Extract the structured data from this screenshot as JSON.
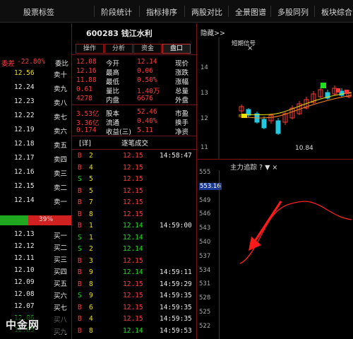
{
  "menu": [
    "板块综合",
    "多股同列",
    "全景图谱",
    "两股对比",
    "指标排序",
    "阶段统计",
    "股票标签"
  ],
  "stock": {
    "title": "600283 钱江水利"
  },
  "tabs": [
    "盘口",
    "资金",
    "分析",
    "操作"
  ],
  "quote_rows": [
    {
      "l": "现价",
      "lv": "12.14",
      "r": "今开",
      "rv": "12.08"
    },
    {
      "l": "涨跌",
      "lv": "0.06",
      "r": "最高",
      "rv": "12.16"
    },
    {
      "l": "涨幅",
      "lv": "0.50%",
      "r": "最低",
      "rv": "11.88"
    },
    {
      "l": "总量",
      "lv": "1.40万",
      "r": "量比",
      "rv": "0.61"
    },
    {
      "l": "外盘",
      "lv": "6676",
      "r": "内盘",
      "rv": "4278"
    }
  ],
  "quote_rows2": [
    {
      "l": "市盈",
      "lv": "52.46",
      "r": "股本",
      "rv": "3.53亿"
    },
    {
      "l": "换手",
      "lv": "0.40%",
      "r": "流通",
      "rv": "3.36亿"
    },
    {
      "l": "净资",
      "lv": "5.11",
      "r": "收益(三)",
      "rv": "0.174"
    }
  ],
  "trade_header": "逐笔成交",
  "trade_header_tag": "[详]",
  "trades": [
    {
      "t": "14:58:47",
      "p": "12.15",
      "v": "2",
      "f": "B"
    },
    {
      "t": "",
      "p": "12.15",
      "v": "4",
      "f": "B"
    },
    {
      "t": "",
      "p": "12.15",
      "v": "5",
      "f": "S"
    },
    {
      "t": "",
      "p": "12.15",
      "v": "5",
      "f": "B"
    },
    {
      "t": "",
      "p": "12.15",
      "v": "7",
      "f": "B"
    },
    {
      "t": "",
      "p": "12.15",
      "v": "8",
      "f": "B"
    },
    {
      "t": "14:59:00",
      "p": "12.14",
      "v": "1",
      "f": "B"
    },
    {
      "t": "",
      "p": "12.14",
      "v": "1",
      "f": "S"
    },
    {
      "t": "",
      "p": "12.14",
      "v": "2",
      "f": "S"
    },
    {
      "t": "",
      "p": "12.15",
      "v": "3",
      "f": "B"
    },
    {
      "t": "14:59:11",
      "p": "12.14",
      "v": "9",
      "f": "B"
    },
    {
      "t": "14:59:29",
      "p": "12.15",
      "v": "8",
      "f": "B"
    },
    {
      "t": "14:59:35",
      "p": "12.15",
      "v": "9",
      "f": "S"
    },
    {
      "t": "14:59:35",
      "p": "12.15",
      "v": "6",
      "f": "B"
    },
    {
      "t": "14:59:35",
      "p": "12.15",
      "v": "4",
      "f": "B"
    },
    {
      "t": "14:59:53",
      "p": "12.14",
      "v": "8",
      "f": "B"
    }
  ],
  "book_top": {
    "label": "委比",
    "value": "-22.80%",
    "side": "委差"
  },
  "book_rows": [
    {
      "n": "卖十",
      "p": "12.56",
      "c": "yellow"
    },
    {
      "n": "卖九",
      "p": "12.24",
      "c": "white"
    },
    {
      "n": "卖八",
      "p": "12.23",
      "c": "white"
    },
    {
      "n": "卖七",
      "p": "12.22",
      "c": "white"
    },
    {
      "n": "卖六",
      "p": "12.19",
      "c": "white"
    },
    {
      "n": "卖五",
      "p": "12.18",
      "c": "white"
    },
    {
      "n": "卖四",
      "p": "12.17",
      "c": "white"
    },
    {
      "n": "卖三",
      "p": "12.16",
      "c": "white"
    },
    {
      "n": "卖二",
      "p": "12.15",
      "c": "white"
    },
    {
      "n": "卖一",
      "p": "12.14",
      "c": "white"
    }
  ],
  "book_rows_buy": [
    {
      "n": "买一",
      "p": "12.13",
      "c": "white"
    },
    {
      "n": "买二",
      "p": "12.12",
      "c": "white"
    },
    {
      "n": "买三",
      "p": "12.11",
      "c": "white"
    },
    {
      "n": "买四",
      "p": "12.10",
      "c": "white"
    },
    {
      "n": "买五",
      "p": "12.09",
      "c": "white"
    },
    {
      "n": "买六",
      "p": "12.08",
      "c": "white"
    },
    {
      "n": "买七",
      "p": "12.07",
      "c": "white"
    },
    {
      "n": "买八",
      "p": "12.06",
      "c": "green"
    },
    {
      "n": "买九",
      "p": "12.05",
      "c": "green"
    },
    {
      "n": "买十",
      "p": "12.04",
      "c": "green"
    }
  ],
  "bar_label": "39%",
  "chart_top": {
    "label": "隐藏>>",
    "sub": "短期信号"
  },
  "price_axis": [
    "14",
    "13",
    "12",
    "11"
  ],
  "low_marker": "10.84",
  "lower_panel": {
    "title": "主力追踪 ? ▼ ×"
  },
  "lower_axis": [
    "555",
    "553.16",
    "549",
    "546",
    "543",
    "540",
    "537",
    "534",
    "531",
    "528",
    "525",
    "522"
  ],
  "watermark": "中金网 cngold.org",
  "colors": {
    "up": "#ff3b3b",
    "down": "#21e021",
    "accent": "#f0e000",
    "line": "#ff2020",
    "frame": "#7a1212"
  }
}
